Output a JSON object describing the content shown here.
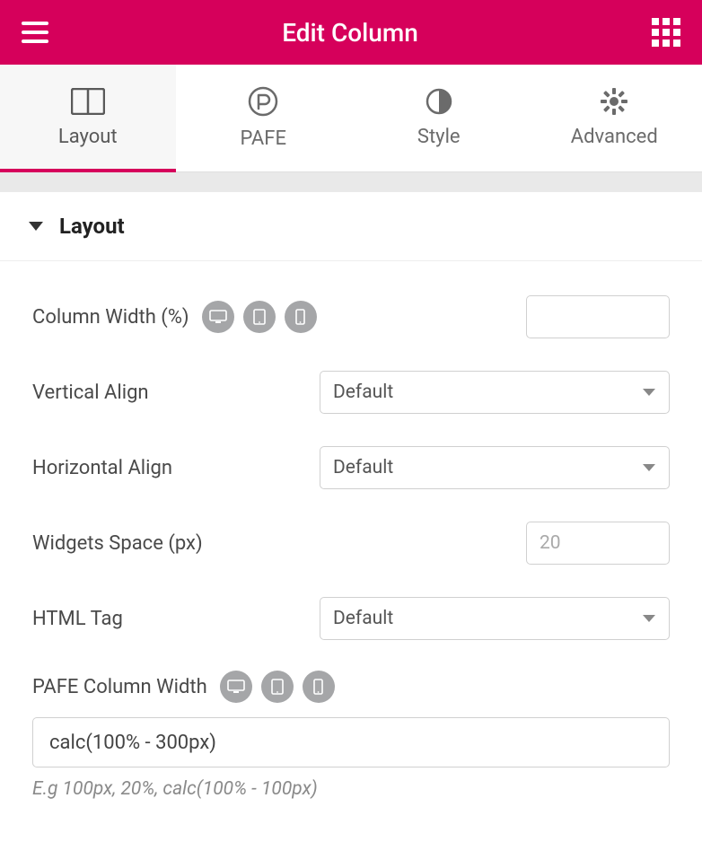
{
  "header": {
    "title": "Edit Column"
  },
  "tabs": {
    "layout": "Layout",
    "pafe": "PAFE",
    "style": "Style",
    "advanced": "Advanced"
  },
  "section": {
    "title": "Layout"
  },
  "controls": {
    "column_width": {
      "label": "Column Width (%)",
      "value": ""
    },
    "vertical_align": {
      "label": "Vertical Align",
      "value": "Default"
    },
    "horizontal_align": {
      "label": "Horizontal Align",
      "value": "Default"
    },
    "widgets_space": {
      "label": "Widgets Space (px)",
      "placeholder": "20",
      "value": ""
    },
    "html_tag": {
      "label": "HTML Tag",
      "value": "Default"
    },
    "pafe_column_width": {
      "label": "PAFE Column Width",
      "value": "calc(100% - 300px)",
      "hint": "E.g 100px, 20%, calc(100% - 100px)"
    }
  },
  "icons": {
    "desktop": "desktop-icon",
    "tablet": "tablet-icon",
    "mobile": "mobile-icon"
  }
}
